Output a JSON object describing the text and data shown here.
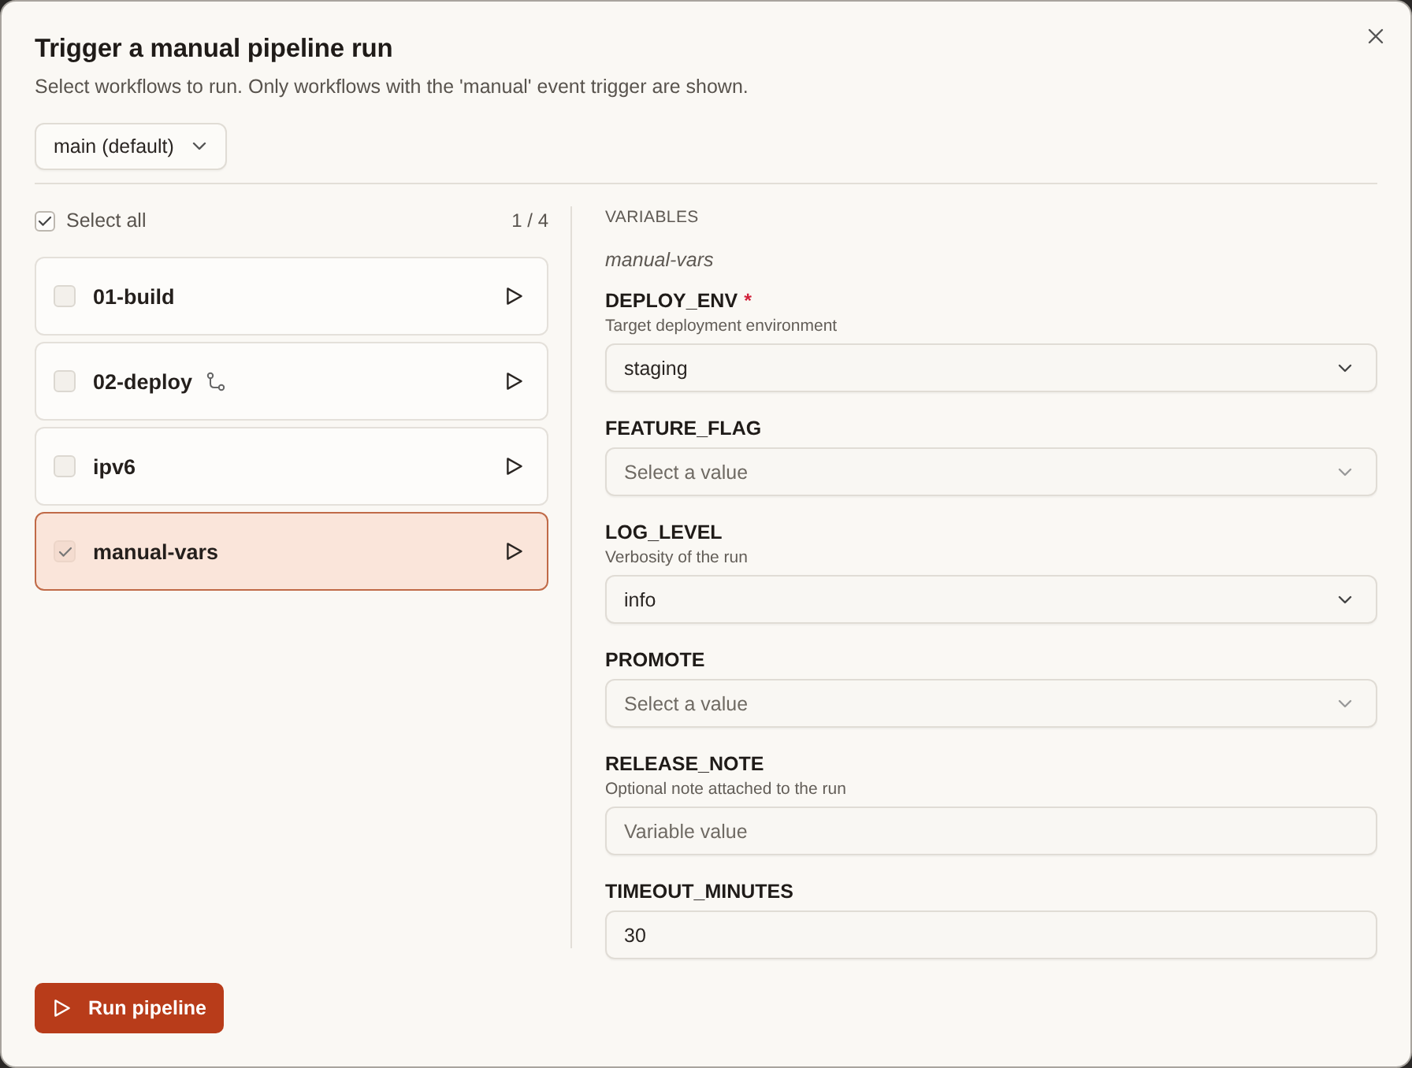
{
  "dialog": {
    "title": "Trigger a manual pipeline run",
    "subtitle": "Select workflows to run. Only workflows with the 'manual' event trigger are shown."
  },
  "branch_select": {
    "value": "main (default)"
  },
  "workflows": {
    "select_all": {
      "label": "Select all",
      "checked": true
    },
    "count": "1 / 4",
    "items": [
      {
        "name": "01-build",
        "checked": false,
        "selected": false,
        "branch_icon": false
      },
      {
        "name": "02-deploy",
        "checked": false,
        "selected": false,
        "branch_icon": true
      },
      {
        "name": "ipv6",
        "checked": false,
        "selected": false,
        "branch_icon": false
      },
      {
        "name": "manual-vars",
        "checked": true,
        "selected": true,
        "branch_icon": false
      }
    ]
  },
  "variables": {
    "heading": "VARIABLES",
    "workflow": "manual-vars",
    "fields": [
      {
        "name": "DEPLOY_ENV",
        "required_mark": "*",
        "description": "Target deployment environment",
        "kind": "select",
        "value": "staging"
      },
      {
        "name": "FEATURE_FLAG",
        "kind": "select",
        "placeholder": "Select a value"
      },
      {
        "name": "LOG_LEVEL",
        "description": "Verbosity of the run",
        "kind": "select",
        "value": "info"
      },
      {
        "name": "PROMOTE",
        "kind": "select",
        "placeholder": "Select a value"
      },
      {
        "name": "RELEASE_NOTE",
        "description": "Optional note attached to the run",
        "kind": "text",
        "placeholder": "Variable value"
      },
      {
        "name": "TIMEOUT_MINUTES",
        "kind": "text",
        "value": "30"
      }
    ]
  },
  "run_button": {
    "label": "Run pipeline"
  }
}
